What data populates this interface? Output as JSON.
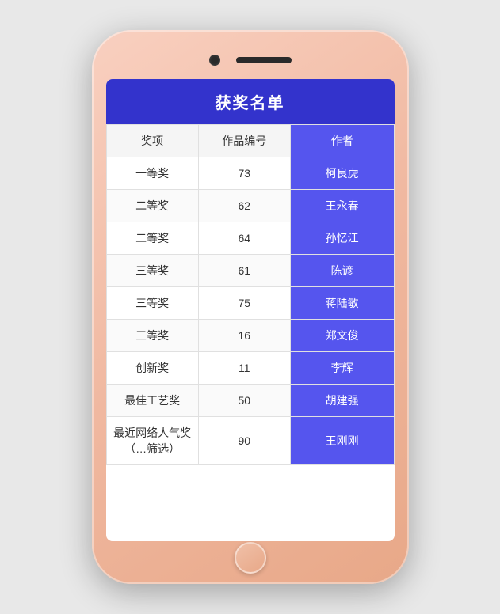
{
  "phone": {
    "title": "获奖名单"
  },
  "table": {
    "headers": {
      "award": "奖项",
      "code": "作品编号",
      "author": "作者"
    },
    "rows": [
      {
        "award": "一等奖",
        "code": "73",
        "author": "柯良虎"
      },
      {
        "award": "二等奖",
        "code": "62",
        "author": "王永春"
      },
      {
        "award": "二等奖",
        "code": "64",
        "author": "孙忆江"
      },
      {
        "award": "三等奖",
        "code": "61",
        "author": "陈谚"
      },
      {
        "award": "三等奖",
        "code": "75",
        "author": "蒋陆敏"
      },
      {
        "award": "三等奖",
        "code": "16",
        "author": "郑文俊"
      },
      {
        "award": "创新奖",
        "code": "11",
        "author": "李辉"
      },
      {
        "award": "最佳工艺奖",
        "code": "50",
        "author": "胡建强"
      },
      {
        "award": "最近网络人气奖（…筛选）",
        "code": "90",
        "author": "王刚刚"
      }
    ]
  }
}
